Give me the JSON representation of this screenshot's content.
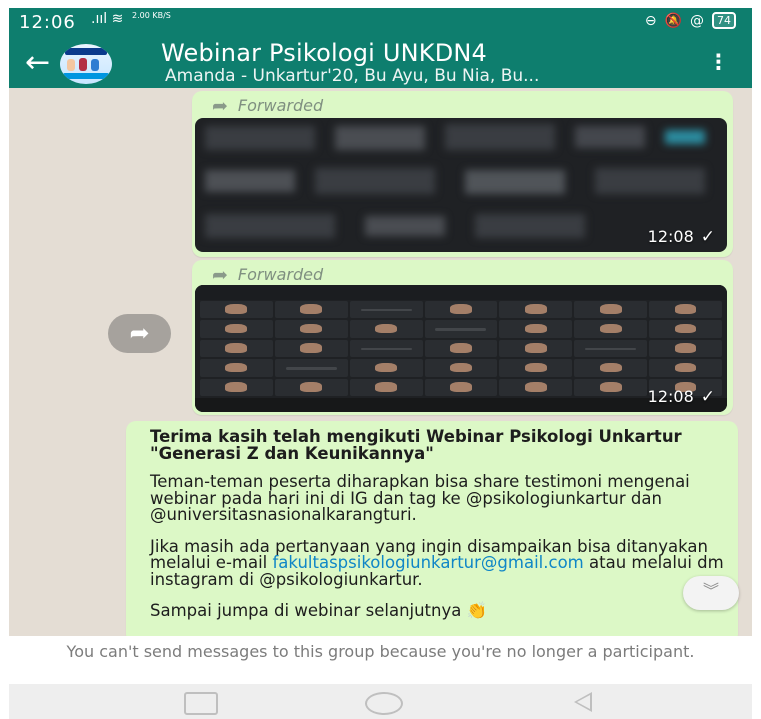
{
  "status_bar": {
    "time": "12:06",
    "signal_icons": ".ııl ≋",
    "speed": "2.00 KB/S",
    "right_icons": [
      "link-icon",
      "muted-bell-icon",
      "at-icon"
    ],
    "battery": "74"
  },
  "header": {
    "title": "Webinar Psikologi UNKDN4",
    "subtitle": "Amanda - Unkartur'20, Bu Ayu, Bu Nia, Bu...",
    "back_icon": "←",
    "menu_icon": "⋮"
  },
  "messages": [
    {
      "forwarded_label": "Forwarded",
      "time": "12:08",
      "tick": "✓"
    },
    {
      "forwarded_label": "Forwarded",
      "time": "12:08",
      "tick": "✓"
    },
    {
      "bold_text": "Terima kasih telah mengikuti Webinar Psikologi Unkartur \"Generasi Z dan Keunikannya\"",
      "paragraph2": "Teman-teman peserta diharapkan bisa share testimoni mengenai webinar pada hari ini di IG dan tag ke @psikologiunkartur dan @universitasnasionalkarangturi.",
      "paragraph3_prefix": "Jika masih ada pertanyaan yang ingin disampaikan bisa ditanyakan melalui e-mail",
      "email": "fakultaspsikologiunkartur@gmail.com",
      "paragraph3_suffix": "atau melalui dm instagram di @psikologiunkartur.",
      "paragraph4": "Sampai jumpa di webinar selanjutnya 👏"
    }
  ],
  "share_icon": "➦",
  "scroll_down_icon": "︾",
  "notice": "You can't send messages to this group because you're no longer a participant.",
  "colors": {
    "header": "#0e7e6e",
    "bubble": "#dcf8c6",
    "chat_bg": "#e4ddd4",
    "link": "#0f86c7"
  }
}
